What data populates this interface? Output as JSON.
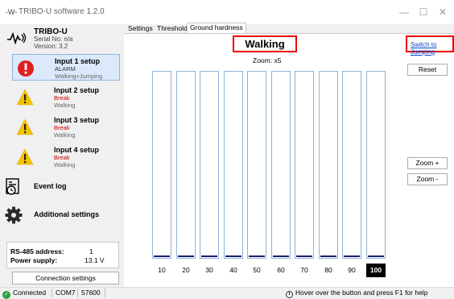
{
  "window": {
    "title": "TRIBO-U software 1.2.0",
    "app_icon": "signal-wave-icon"
  },
  "brand": {
    "name": "TRIBO-U",
    "serial": "Serial No: n/a",
    "version": "Version: 3.2",
    "logo_icon": "signal-wave-icon"
  },
  "setups": [
    {
      "name": "Input 1 setup",
      "status": "ALARM",
      "mode": "Walking+Jumping",
      "icon": "red-alarm-icon"
    },
    {
      "name": "Input 2 setup",
      "status": "Break",
      "mode": "Walking",
      "icon": "yellow-warning-icon"
    },
    {
      "name": "Input 3 setup",
      "status": "Break",
      "mode": "Walking",
      "icon": "yellow-warning-icon"
    },
    {
      "name": "Input 4 setup",
      "status": "Break",
      "mode": "Walking",
      "icon": "yellow-warning-icon"
    }
  ],
  "nav": {
    "event_log": "Event log",
    "additional_settings": "Additional settings"
  },
  "info": {
    "rs485_label": "RS-485 address:",
    "rs485_value": "1",
    "power_label": "Power supply:",
    "power_value": "13.1 V"
  },
  "connection_button": "Connection settings",
  "tabs": [
    {
      "label": "Settings"
    },
    {
      "label": "Threshold"
    },
    {
      "label": "Ground hardness"
    }
  ],
  "content": {
    "title": "Walking",
    "switch_link": "Switch to Jumping",
    "zoom_label": "Zoom: x5",
    "reset": "Reset",
    "zoom_in": "Zoom +",
    "zoom_out": "Zoom -",
    "bars": [
      {
        "label": "10",
        "level": 0.01
      },
      {
        "label": "20",
        "level": 0.01
      },
      {
        "label": "30",
        "level": 0.01
      },
      {
        "label": "40",
        "level": 0.01
      },
      {
        "label": "50",
        "level": 0.01
      },
      {
        "label": "60",
        "level": 0.01
      },
      {
        "label": "70",
        "level": 0.01
      },
      {
        "label": "80",
        "level": 0.01
      },
      {
        "label": "90",
        "level": 0.01
      },
      {
        "label": "100",
        "level": 0.01,
        "selected": true
      }
    ]
  },
  "statusbar": {
    "connected": "Connected",
    "port": "COM7",
    "baud": "57600",
    "hint": "Hover over the button and press F1 for help"
  }
}
